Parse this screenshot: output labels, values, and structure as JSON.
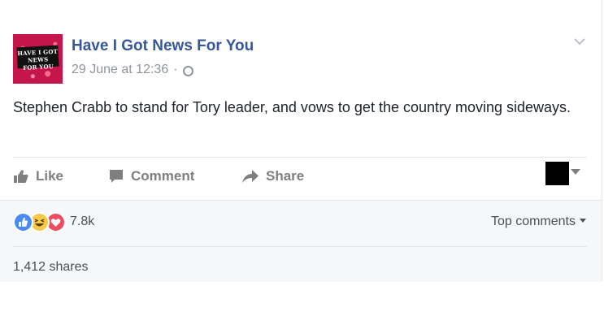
{
  "post": {
    "page_name": "Have I Got News For You",
    "timestamp": "29 June at 12:36",
    "separator": "·",
    "privacy_icon": "globe-icon",
    "avatar_text_line1": "HAVE I GOT NEWS",
    "avatar_text_line2": "FOR YOU",
    "text": "Stephen Crabb to stand for Tory leader, and vows to get the country moving sideways."
  },
  "actions": {
    "like_label": "Like",
    "comment_label": "Comment",
    "share_label": "Share"
  },
  "footer": {
    "reaction_icons": [
      "like-reaction-icon",
      "haha-reaction-icon",
      "love-reaction-icon"
    ],
    "reaction_count": "7.8k",
    "top_comments_label": "Top comments",
    "shares_label": "1,412 shares"
  },
  "colors": {
    "link_blue": "#365899",
    "meta_gray": "#90949c",
    "action_gray": "#7f7f7f",
    "footer_bg": "#f6f7f9",
    "like_blue": "#4a8af4",
    "love_red": "#ee4b61",
    "haha_yellow": "#f7c949"
  }
}
